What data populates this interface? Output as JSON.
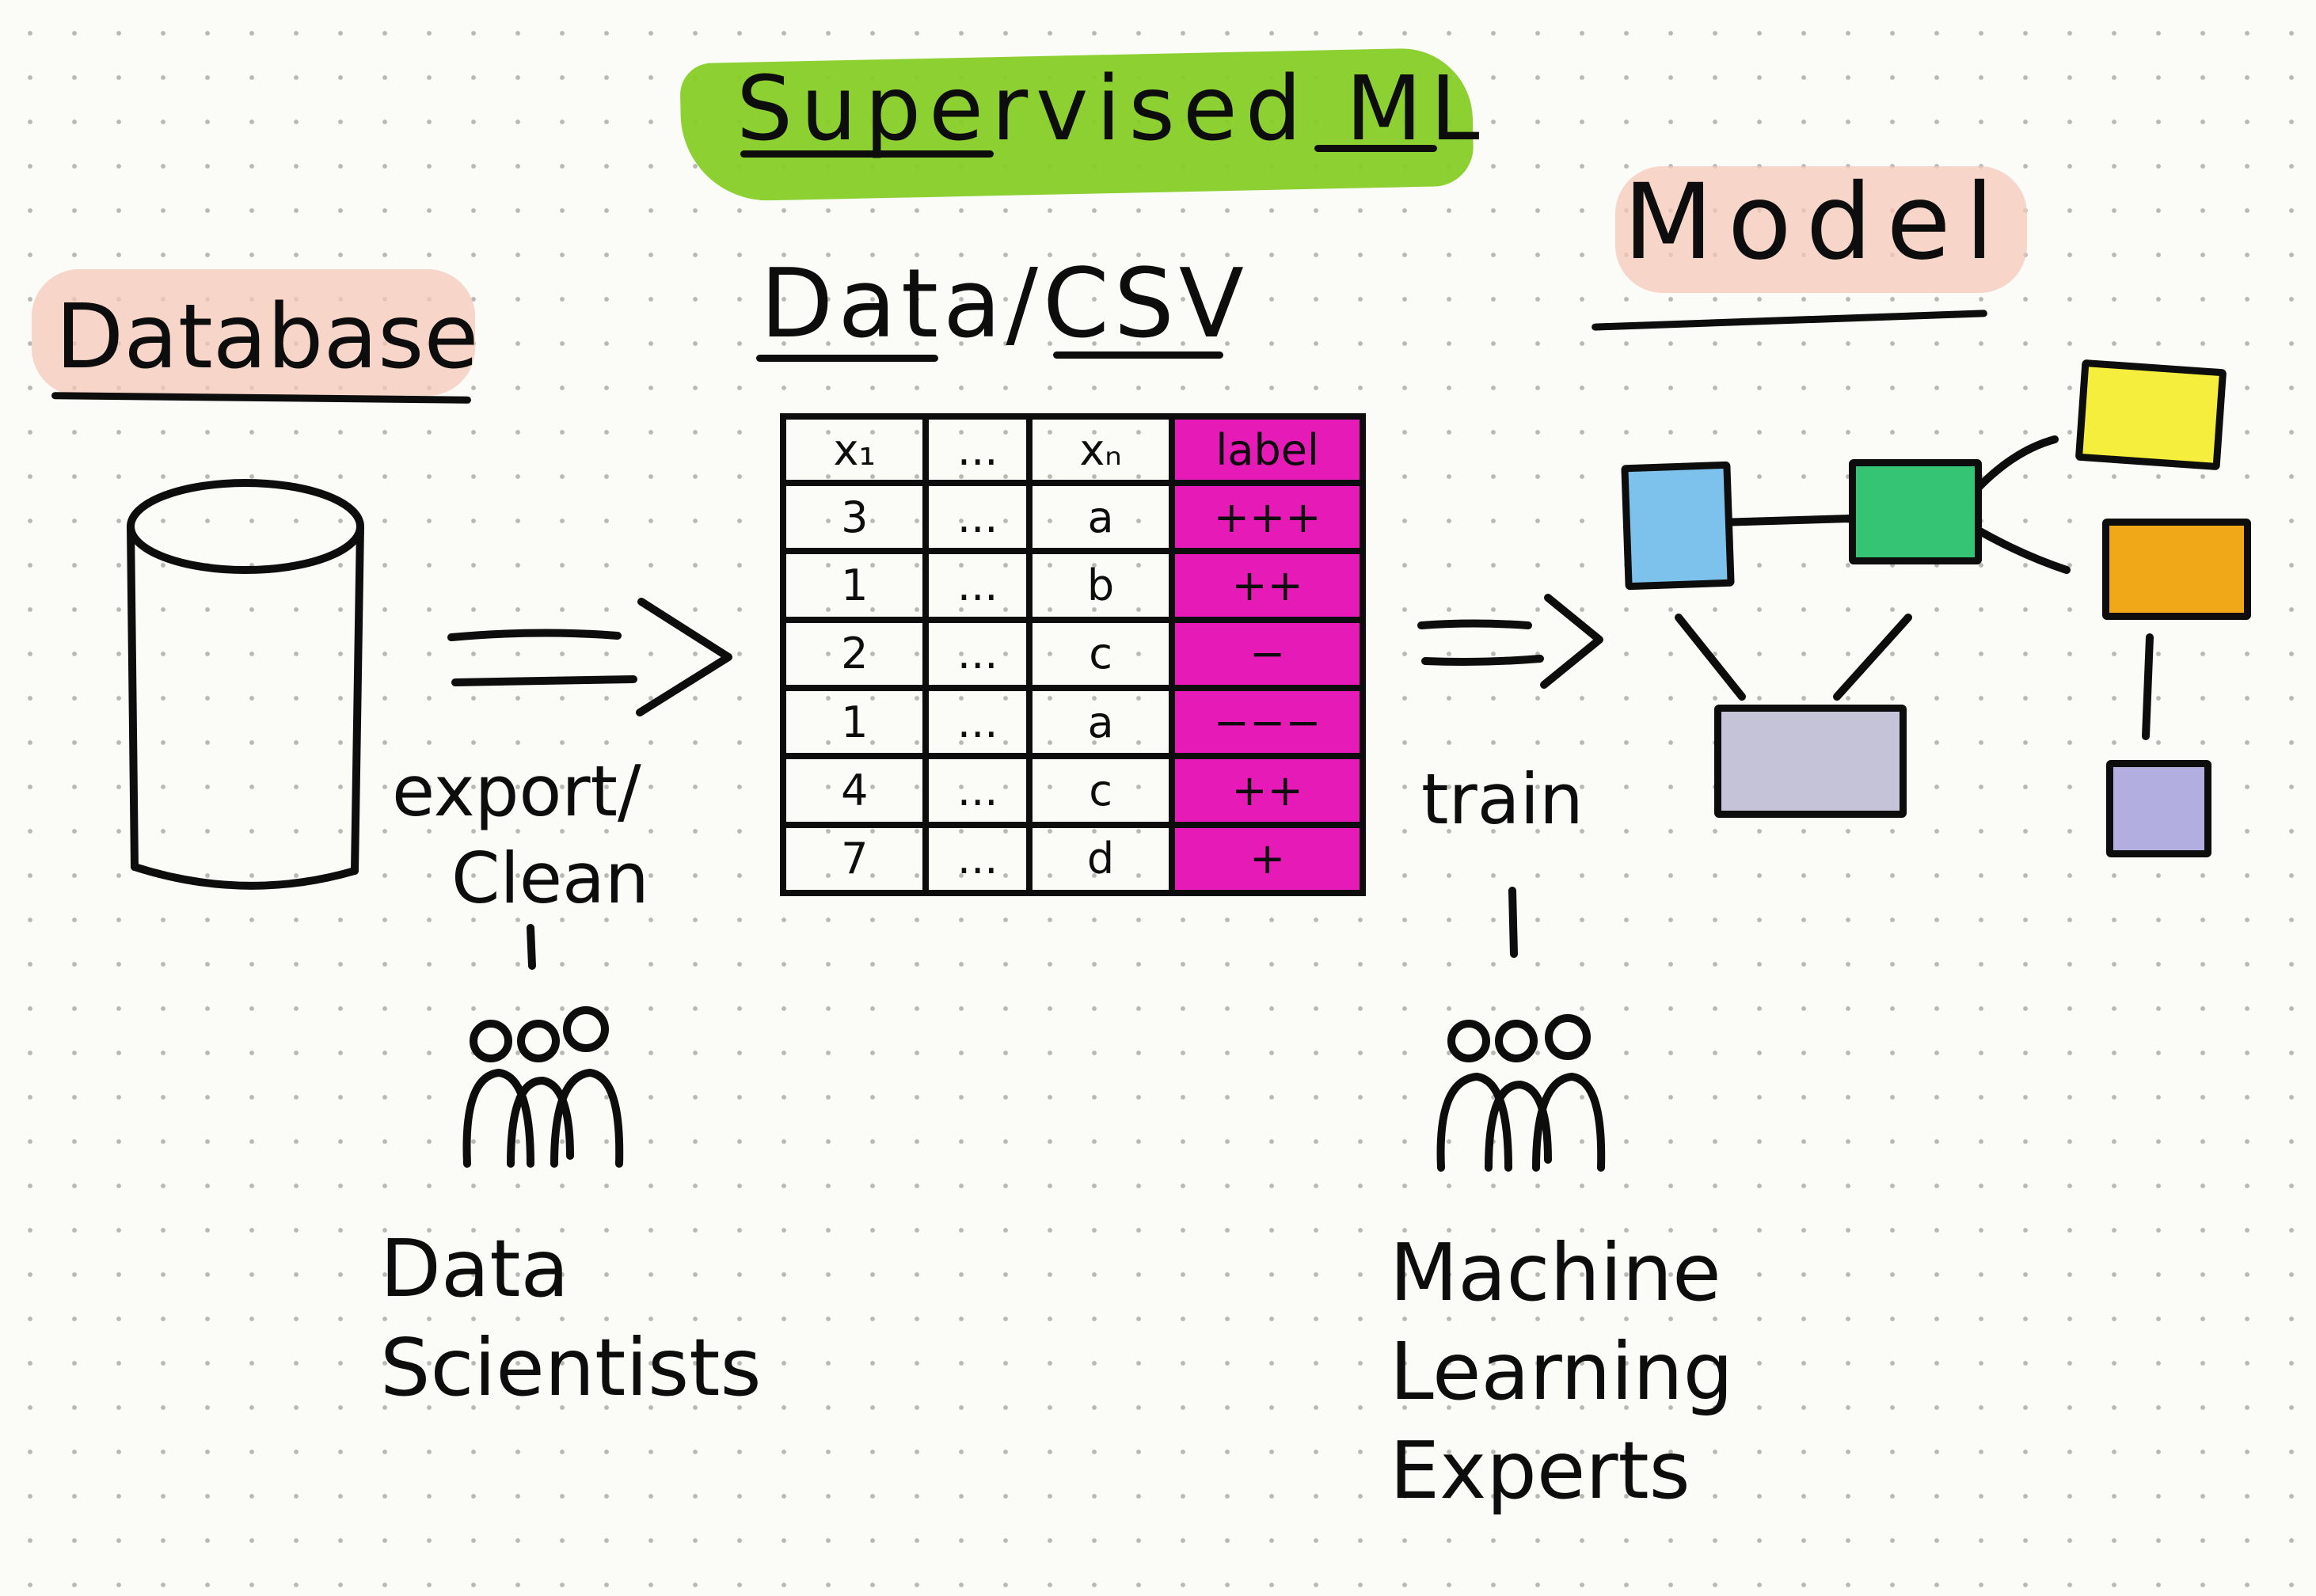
{
  "title": "Supervised ML",
  "stages": {
    "database": "Database",
    "data": "Data/CSV",
    "model": "Model"
  },
  "table": {
    "headers": [
      "x₁",
      "...",
      "xₙ",
      "label"
    ],
    "rows": [
      [
        "3",
        "...",
        "a",
        "+++"
      ],
      [
        "1",
        "...",
        "b",
        "++"
      ],
      [
        "2",
        "...",
        "c",
        "−"
      ],
      [
        "1",
        "...",
        "a",
        "−−−"
      ],
      [
        "4",
        "...",
        "c",
        "++"
      ],
      [
        "7",
        "...",
        "d",
        "+"
      ]
    ]
  },
  "steps": {
    "export_line1": "export/",
    "export_line2": "Clean",
    "train": "train"
  },
  "roles": {
    "data_scientists_line1": "Data",
    "data_scientists_line2": "Scientists",
    "ml_experts_line1": "Machine",
    "ml_experts_line2": "Learning",
    "ml_experts_line3": "Experts"
  },
  "icons": {
    "database": "database-cylinder-icon",
    "people": "people-group-icon",
    "arrow": "double-arrow-icon"
  },
  "colors": {
    "title_highlight": "#83cc20",
    "heading_highlight": "#f6c8b8",
    "label_column": "#e61ab7",
    "node_blue": "#7cc2ec",
    "node_green": "#34c473",
    "node_yellow": "#f6ee3c",
    "node_orange": "#f0a818",
    "node_gray": "#c5c3d8",
    "node_lavender": "#b3aee0"
  }
}
